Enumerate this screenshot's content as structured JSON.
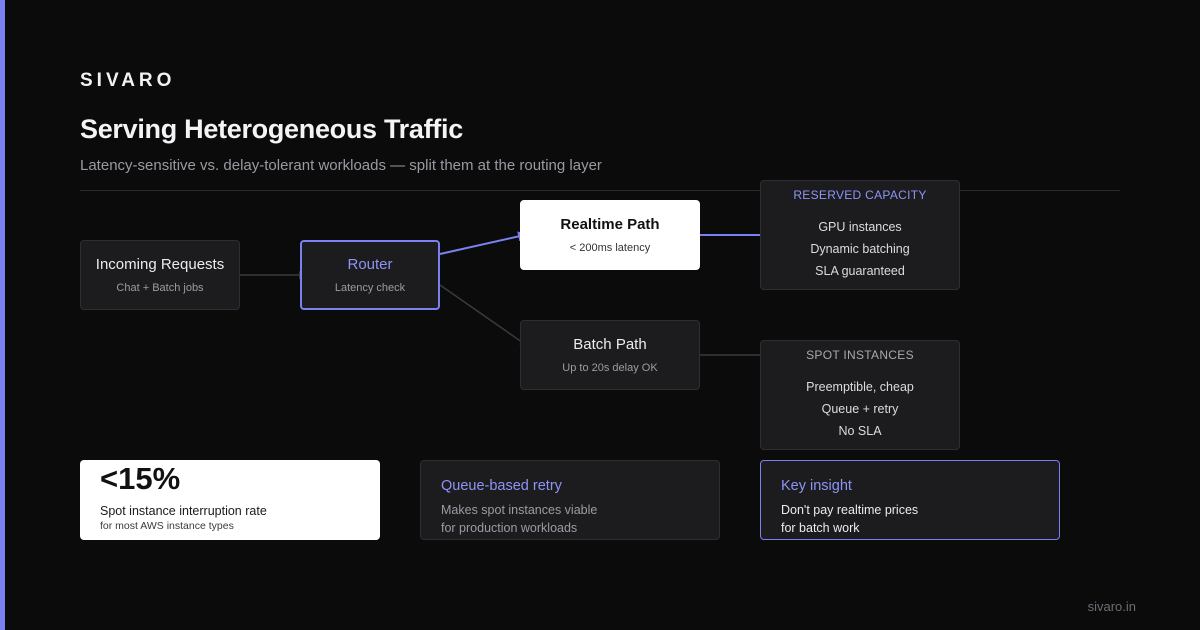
{
  "brand": "SIVARO",
  "title": "Serving Heterogeneous Traffic",
  "subtitle": "Latency-sensitive vs. delay-tolerant workloads — split them at the routing layer",
  "nodes": {
    "incoming": {
      "title": "Incoming Requests",
      "sub": "Chat + Batch jobs"
    },
    "router": {
      "title": "Router",
      "sub": "Latency check"
    },
    "realtime": {
      "title": "Realtime Path",
      "sub": "< 200ms latency"
    },
    "batch": {
      "title": "Batch Path",
      "sub": "Up to 20s delay OK"
    }
  },
  "capacity": {
    "reserved": {
      "heading": "RESERVED CAPACITY",
      "items": [
        "GPU instances",
        "Dynamic batching",
        "SLA guaranteed"
      ]
    },
    "spot": {
      "heading": "SPOT INSTANCES",
      "items": [
        "Preemptible, cheap",
        "Queue + retry",
        "No SLA"
      ]
    }
  },
  "stat": {
    "value": "<15%",
    "label": "Spot instance interruption rate",
    "note": "for most AWS instance types"
  },
  "retry": {
    "title": "Queue-based retry",
    "line1": "Makes spot instances viable",
    "line2": "for production workloads"
  },
  "insight": {
    "title": "Key insight",
    "line1": "Don't pay realtime prices",
    "line2": "for batch work"
  },
  "footer": "sivaro.in",
  "colors": {
    "accent": "#7b82f0",
    "background": "#0b0b0c",
    "panel": "#1c1c1f",
    "muted_arrow": "#3a3a3f"
  }
}
